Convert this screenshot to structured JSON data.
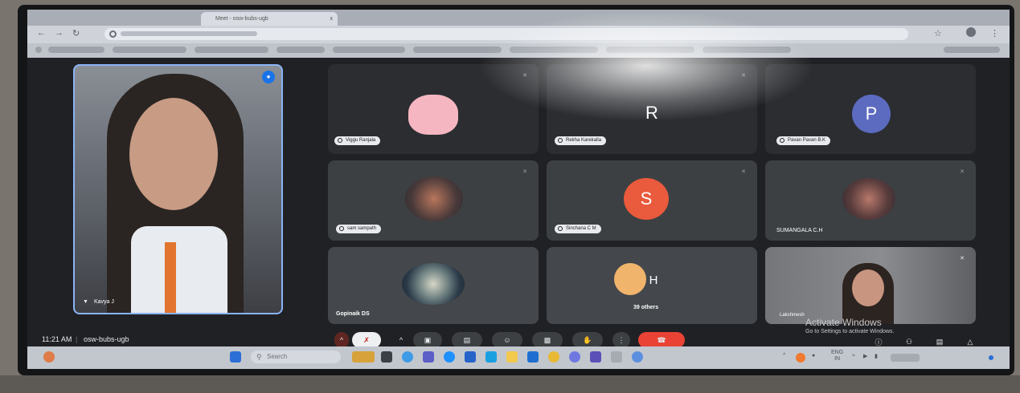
{
  "browser": {
    "tab_title": "Meet - osw-bubs-ugb",
    "tab_close": "x"
  },
  "meet": {
    "featured": {
      "name": "Kavya J"
    },
    "tiles": [
      {
        "id": "viggu",
        "label": "Viggu Ranjala",
        "avatar_color": "#f28b82"
      },
      {
        "id": "rekha",
        "label": "Rekha Karekalla",
        "letter": "R",
        "avatar_color": "#3c4043"
      },
      {
        "id": "pavan",
        "label": "Pavan Pavan B.K",
        "letter": "P",
        "avatar_color": "#5c6bc0"
      },
      {
        "id": "sam",
        "label": "sam sampath"
      },
      {
        "id": "sinchana",
        "label": "Sinchana C M",
        "letter": "S",
        "avatar_color": "#ea5a3c"
      },
      {
        "id": "sumangala",
        "label": "SUMANGALA C.H"
      },
      {
        "id": "gopinaik",
        "label": "Gopinaik DS"
      },
      {
        "id": "others",
        "label": "39 others",
        "letter": "H",
        "avatar_color": "#3f74c9"
      },
      {
        "id": "presenter",
        "label": "Lakshmesh"
      }
    ],
    "time": "11:21 AM",
    "meeting_code": "osw-bubs-ugb",
    "activate_title": "Activate Windows",
    "activate_sub": "Go to Settings to activate Windows."
  },
  "taskbar": {
    "search_placeholder": "Search",
    "lang_line1": "ENG",
    "lang_line2": "IN"
  },
  "colors": {
    "accent": "#8ab4f8",
    "hangup": "#ea4335",
    "tile_bg": "#3c4043"
  }
}
